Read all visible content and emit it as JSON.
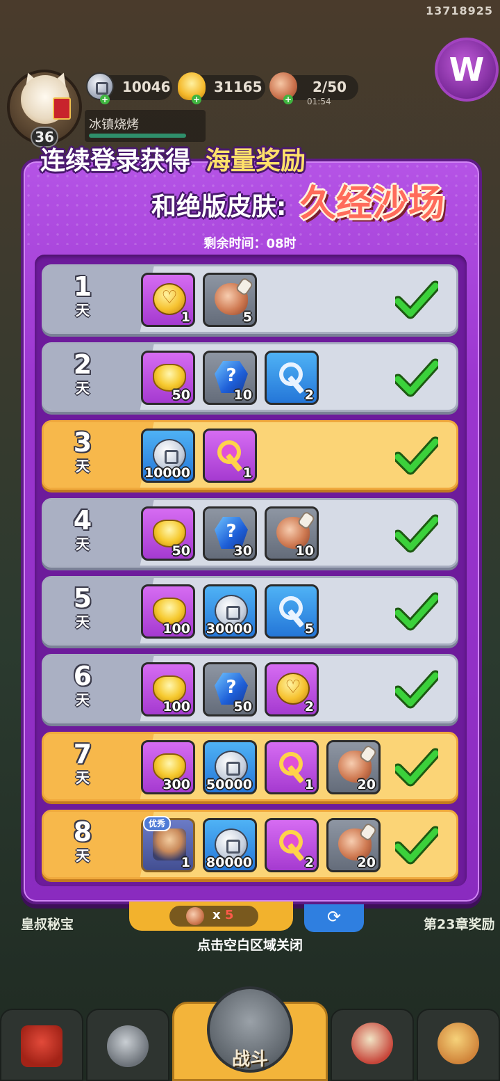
{
  "hud": {
    "uid": "13718925",
    "level": "36",
    "player_name": "冰镇烧烤",
    "silver": "10046",
    "gold": "31165",
    "stamina": "2/50",
    "stamina_timer": "01:54"
  },
  "popup": {
    "title_line1_prefix": "连续登录获得",
    "title_line1_highlight": "海量奖励",
    "title_line2_prefix": "和绝版皮肤:",
    "title_line2_skin": "久经沙场",
    "remaining_time": "剩余时间：08时",
    "day_unit": "天",
    "claimed_icon": "checkmark-icon",
    "days": [
      {
        "day": "1",
        "style": "grey",
        "rewards": [
          {
            "icon": "gold-coin-icon",
            "bg": "purple",
            "count": "1"
          },
          {
            "icon": "meat-icon",
            "bg": "grey",
            "count": "5"
          }
        ]
      },
      {
        "day": "2",
        "style": "grey",
        "rewards": [
          {
            "icon": "gold-ingot-icon",
            "bg": "purple",
            "count": "50"
          },
          {
            "icon": "mystery-gem-icon",
            "bg": "grey",
            "count": "10"
          },
          {
            "icon": "silver-key-icon",
            "bg": "blue",
            "count": "2"
          }
        ]
      },
      {
        "day": "3",
        "style": "gold",
        "rewards": [
          {
            "icon": "silver-coin-icon",
            "bg": "blue",
            "count": "10000"
          },
          {
            "icon": "gold-key-icon",
            "bg": "purple",
            "count": "1"
          }
        ]
      },
      {
        "day": "4",
        "style": "grey",
        "rewards": [
          {
            "icon": "gold-ingot-icon",
            "bg": "purple",
            "count": "50"
          },
          {
            "icon": "mystery-gem-icon",
            "bg": "grey",
            "count": "30"
          },
          {
            "icon": "meat-icon",
            "bg": "grey",
            "count": "10"
          }
        ]
      },
      {
        "day": "5",
        "style": "grey",
        "rewards": [
          {
            "icon": "gold-ingot-icon",
            "bg": "purple",
            "count": "100"
          },
          {
            "icon": "silver-coin-icon",
            "bg": "blue",
            "count": "30000"
          },
          {
            "icon": "silver-key-icon",
            "bg": "blue",
            "count": "5"
          }
        ]
      },
      {
        "day": "6",
        "style": "grey",
        "rewards": [
          {
            "icon": "gold-ingot-icon",
            "bg": "purple",
            "count": "100"
          },
          {
            "icon": "mystery-gem-icon",
            "bg": "grey",
            "count": "50"
          },
          {
            "icon": "gold-coin-icon",
            "bg": "purple",
            "count": "2"
          }
        ]
      },
      {
        "day": "7",
        "style": "gold",
        "rewards": [
          {
            "icon": "gold-ingot-icon",
            "bg": "purple",
            "count": "300"
          },
          {
            "icon": "silver-coin-icon",
            "bg": "blue",
            "count": "50000"
          },
          {
            "icon": "gold-key-icon",
            "bg": "purple",
            "count": "1"
          },
          {
            "icon": "meat-icon",
            "bg": "grey",
            "count": "20"
          }
        ]
      },
      {
        "day": "8",
        "style": "gold",
        "rewards": [
          {
            "icon": "hero-portrait-icon",
            "bg": "hero",
            "count": "1",
            "tag": "优秀"
          },
          {
            "icon": "silver-coin-icon",
            "bg": "blue",
            "count": "80000"
          },
          {
            "icon": "gold-key-icon",
            "bg": "purple",
            "count": "2"
          },
          {
            "icon": "meat-icon",
            "bg": "grey",
            "count": "20"
          }
        ]
      }
    ]
  },
  "under": {
    "close_hint": "点击空白区域关闭",
    "left_label": "皇叔秘宝",
    "right_label": "第23章奖励",
    "meat_cost_prefix": "x",
    "meat_cost_value": "5"
  },
  "nav": {
    "battle_label": "战斗"
  },
  "colors": {
    "popup_purple": "#9b36cf",
    "row_grey": "#d6dbe6",
    "row_gold": "#fbd476",
    "check_green": "#3bd13b"
  }
}
